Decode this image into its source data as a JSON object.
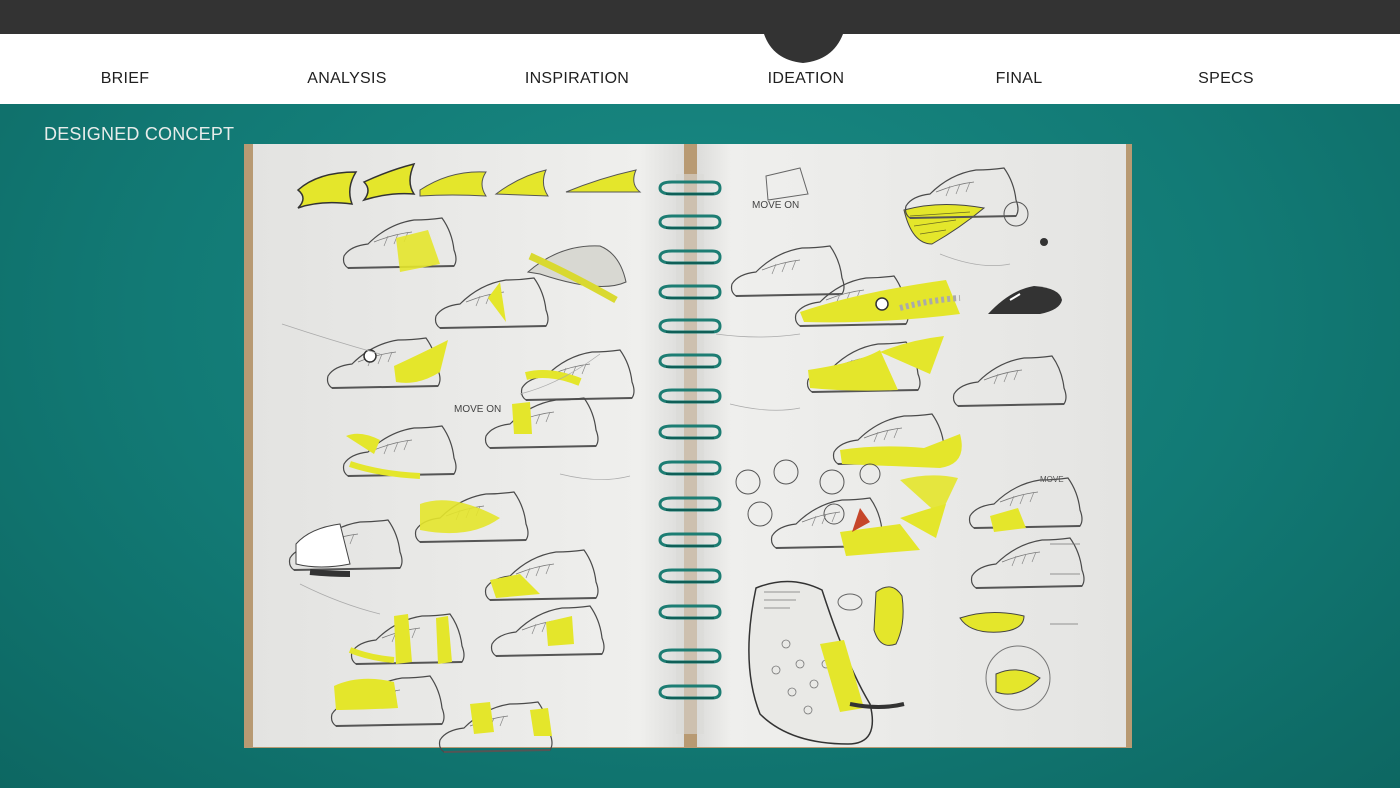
{
  "nav": {
    "items": [
      {
        "label": "BRIEF"
      },
      {
        "label": "ANALYSIS"
      },
      {
        "label": "INSPIRATION"
      },
      {
        "label": "IDEATION"
      },
      {
        "label": "FINAL"
      },
      {
        "label": "SPECS"
      }
    ],
    "active": "IDEATION"
  },
  "section": {
    "title": "DESIGNED CONCEPT"
  },
  "sketch": {
    "left_page_note": "MOVE ON",
    "right_page_note": "MOVE ON"
  },
  "colors": {
    "topbar": "#333333",
    "nav_bg": "#ffffff",
    "background": "#127a75",
    "accent_yellow": "#e4e62b",
    "paper": "#eeeeec",
    "spiral": "#1d7d73"
  }
}
